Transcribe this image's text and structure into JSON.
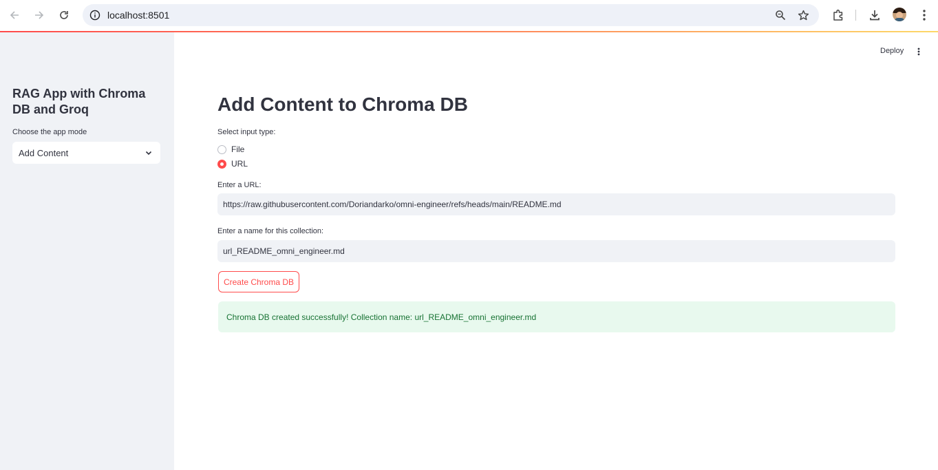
{
  "browser": {
    "url": "localhost:8501",
    "icons": [
      "back-arrow-icon",
      "forward-arrow-icon",
      "reload-icon",
      "site-info-icon",
      "zoom-icon",
      "bookmark-star-icon",
      "extensions-icon",
      "download-icon",
      "profile-avatar",
      "kebab-menu-icon"
    ]
  },
  "sidebar": {
    "title": "RAG App with Chroma DB and Groq",
    "mode_label": "Choose the app mode",
    "mode_value": "Add Content"
  },
  "header": {
    "deploy_label": "Deploy"
  },
  "main": {
    "title": "Add Content to Chroma DB",
    "input_type_label": "Select input type:",
    "radio_options": [
      {
        "label": "File",
        "selected": false
      },
      {
        "label": "URL",
        "selected": true
      }
    ],
    "url_label": "Enter a URL:",
    "url_value": "https://raw.githubusercontent.com/Doriandarko/omni-engineer/refs/heads/main/README.md",
    "collection_label": "Enter a name for this collection:",
    "collection_value": "url_README_omni_engineer.md",
    "create_button": "Create Chroma DB",
    "success_message": "Chroma DB created successfully! Collection name: url_README_omni_engineer.md"
  },
  "colors": {
    "accent": "#ff4b4b",
    "sidebar_bg": "#f0f2f6",
    "success_bg": "#e8f9ee",
    "success_text": "#177233",
    "text": "#31333f"
  }
}
